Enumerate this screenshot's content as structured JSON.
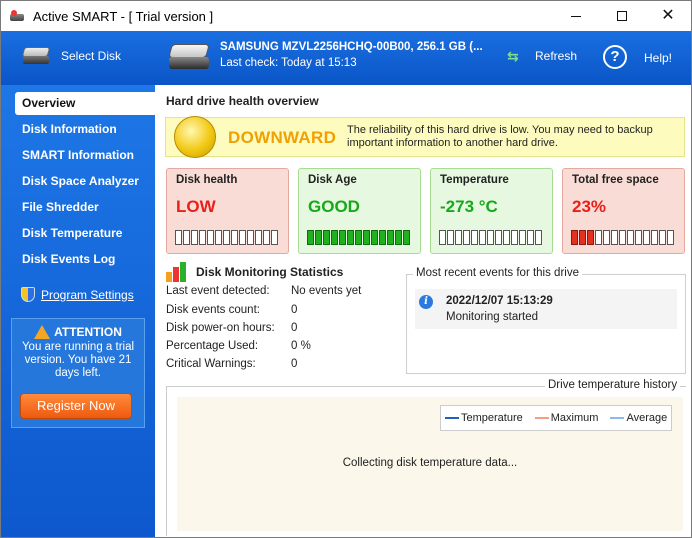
{
  "window": {
    "title": "Active SMART - [ Trial version ]"
  },
  "toolbar": {
    "select_disk": "Select Disk",
    "drive_name": "SAMSUNG MZVL2256HCHQ-00B00, 256.1 GB (...",
    "last_check": "Last check: Today at 15:13",
    "refresh": "Refresh",
    "help": "Help!"
  },
  "sidebar": {
    "items": [
      {
        "label": "Overview",
        "active": true
      },
      {
        "label": "Disk Information"
      },
      {
        "label": "SMART Information"
      },
      {
        "label": "Disk Space Analyzer"
      },
      {
        "label": "File Shredder"
      },
      {
        "label": "Disk Temperature"
      },
      {
        "label": "Disk Events Log"
      }
    ],
    "program_settings": "Program Settings",
    "attention": {
      "title": "ATTENTION",
      "text": "You are running a trial version. You have 21 days left.",
      "register": "Register Now"
    }
  },
  "main": {
    "title": "Hard drive health overview",
    "banner": {
      "status": "DOWNWARD",
      "text": "The reliability of this hard drive is low. You may need to backup important information to another hard drive."
    },
    "cards": [
      {
        "title": "Disk health",
        "value": "LOW",
        "value_color": "#e8201a",
        "style": "red",
        "level_segments": 0,
        "fill": "none"
      },
      {
        "title": "Disk Age",
        "value": "GOOD",
        "value_color": "#18a81e",
        "style": "green",
        "level_segments": 15,
        "fill": "g"
      },
      {
        "title": "Temperature",
        "value": "-273 °C",
        "value_color": "#18a81e",
        "style": "green",
        "level_segments": 0,
        "fill": "none"
      },
      {
        "title": "Total free space",
        "value": "23%",
        "value_color": "#e8201a",
        "style": "red",
        "level_segments": 3,
        "fill": "r"
      }
    ],
    "stats": {
      "title": "Disk Monitoring Statistics",
      "rows": [
        {
          "label": "Last event detected:",
          "value": "No events yet"
        },
        {
          "label": "Disk events count:",
          "value": "0"
        },
        {
          "label": "Disk power-on hours:",
          "value": "0"
        },
        {
          "label": "Percentage Used:",
          "value": "0 %"
        },
        {
          "label": "Critical Warnings:",
          "value": "0"
        }
      ]
    },
    "events": {
      "title": "Most recent events for this drive",
      "items": [
        {
          "time": "2022/12/07 15:13:29",
          "message": "Monitoring started"
        }
      ]
    },
    "temperature_history": {
      "title": "Drive temperature history",
      "legend": [
        {
          "name": "Temperature",
          "color": "#2060c0"
        },
        {
          "name": "Maximum",
          "color": "#f0a080"
        },
        {
          "name": "Average",
          "color": "#90b8e8"
        }
      ],
      "status": "Collecting disk temperature data..."
    }
  }
}
